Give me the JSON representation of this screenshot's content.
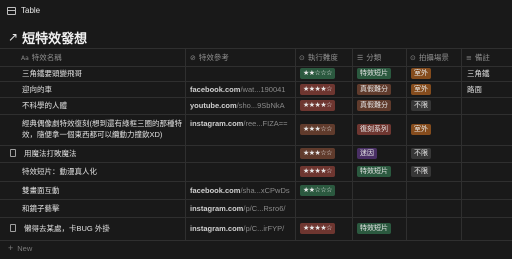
{
  "window": {
    "view_label": "Table",
    "table_icon": "table-icon"
  },
  "page": {
    "title": "短特效發想",
    "title_icon": "arrow-up-right-icon"
  },
  "columns": [
    {
      "label": "特效名稱",
      "icon": "Aa"
    },
    {
      "label": "特效參考",
      "icon": "link-icon"
    },
    {
      "label": "執行難度",
      "icon": "select-icon"
    },
    {
      "label": "分類",
      "icon": "list-icon"
    },
    {
      "label": "拍攝場景",
      "icon": "select-icon"
    },
    {
      "label": "備註",
      "icon": "text-icon"
    }
  ],
  "rows": [
    {
      "name": "三角鐵要頭變飛哥",
      "doc": false,
      "url": "",
      "url_tail": "",
      "rating": "★★☆☆☆",
      "rating_color": "green",
      "category": "特效短片",
      "category_color": "green",
      "scene": "室外",
      "scene_color": "orange",
      "note": "三角鐵"
    },
    {
      "name": "迎向的車",
      "doc": false,
      "url": "facebook.com",
      "url_tail": "/wat...190041",
      "rating": "★★★★☆",
      "rating_color": "red",
      "category": "真假難分",
      "category_color": "brown",
      "scene": "室外",
      "scene_color": "orange",
      "note": "路面"
    },
    {
      "name": "不科學的人體",
      "doc": false,
      "url": "youtube.com",
      "url_tail": "/sho...9SbNkA",
      "rating": "★★★★☆",
      "rating_color": "red",
      "category": "真假難分",
      "category_color": "brown",
      "scene": "不限",
      "scene_color": "gray",
      "note": ""
    },
    {
      "name": "經典偶像劇特效復刻(想到還有綠框三圈的那種特效，隨便拿一個東西都可以纜動力撞飲XD)",
      "doc": false,
      "url": "instagram.com",
      "url_tail": "/ree...FIZA==",
      "rating": "★★★☆☆",
      "rating_color": "brown",
      "category": "復刻系列",
      "category_color": "red",
      "scene": "室外",
      "scene_color": "orange",
      "note": ""
    },
    {
      "name": "用魔法打敗魔法",
      "doc": true,
      "url": "",
      "url_tail": "",
      "rating": "★★★☆☆",
      "rating_color": "brown",
      "category": "迷因",
      "category_color": "purple",
      "scene": "不限",
      "scene_color": "gray",
      "note": ""
    },
    {
      "name": "特效短片：動漫真人化",
      "doc": false,
      "url": "",
      "url_tail": "",
      "rating": "★★★★☆",
      "rating_color": "red",
      "category": "特效短片",
      "category_color": "green",
      "scene": "不限",
      "scene_color": "gray",
      "note": ""
    },
    {
      "name": "雙畫面互動",
      "doc": false,
      "url": "facebook.com",
      "url_tail": "/sha...xCPwDs",
      "rating": "★★☆☆☆",
      "rating_color": "green",
      "category": "",
      "category_color": "",
      "scene": "",
      "scene_color": "",
      "note": ""
    },
    {
      "name": "和鏡子藝擊",
      "doc": false,
      "url": "instagram.com",
      "url_tail": "/p/C...Rsro6/",
      "rating": "",
      "rating_color": "",
      "category": "",
      "category_color": "",
      "scene": "",
      "scene_color": "",
      "note": ""
    },
    {
      "name": "懶得去某處，卡BUG 外掛",
      "doc": true,
      "url": "instagram.com",
      "url_tail": "/p/C...irFYP/",
      "rating": "★★★★☆",
      "rating_color": "red",
      "category": "特效短片",
      "category_color": "green",
      "scene": "",
      "scene_color": "",
      "note": ""
    }
  ],
  "footer": {
    "new_label": "New"
  }
}
